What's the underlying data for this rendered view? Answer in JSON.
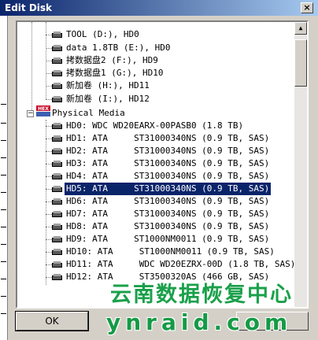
{
  "window": {
    "title": "Edit Disk",
    "close_label": "×"
  },
  "tree": {
    "volumes": [
      "TOOL (D:), HD0",
      "data 1.8TB (E:), HD0",
      "拷数据盘2 (F:), HD9",
      "拷数据盘1 (G:), HD10",
      "新加卷 (H:), HD11",
      "新加卷 (I:), HD12"
    ],
    "physical_media": {
      "label": "Physical Media",
      "expander": "−",
      "logo_text": "HEX",
      "disks": [
        "HD0: WDC WD20EARX-00PASB0 (1.8 TB)",
        "HD1: ATA     ST31000340NS (0.9 TB, SAS)",
        "HD2: ATA     ST31000340NS (0.9 TB, SAS)",
        "HD3: ATA     ST31000340NS (0.9 TB, SAS)",
        "HD4: ATA     ST31000340NS (0.9 TB, SAS)",
        "HD5: ATA     ST31000340NS (0.9 TB, SAS)",
        "HD6: ATA     ST31000340NS (0.9 TB, SAS)",
        "HD7: ATA     ST31000340NS (0.9 TB, SAS)",
        "HD8: ATA     ST31000340NS (0.9 TB, SAS)",
        "HD9: ATA     ST1000NM0011 (0.9 TB, SAS)",
        "HD10: ATA     ST1000NM0011 (0.9 TB, SAS)",
        "HD11: ATA     WDC WD20EZRX-00D (1.8 TB, SAS)",
        "HD12: ATA     ST3500320AS (466 GB, SAS)"
      ],
      "selected_index": 5
    }
  },
  "buttons": {
    "ok": "OK"
  },
  "watermark": {
    "line1": "云南数据恢复中心",
    "line2": "ynraid.com"
  },
  "colors": {
    "selection": "#0a246a",
    "titlebar": "#0a246a",
    "watermark": "#1aa04a"
  }
}
